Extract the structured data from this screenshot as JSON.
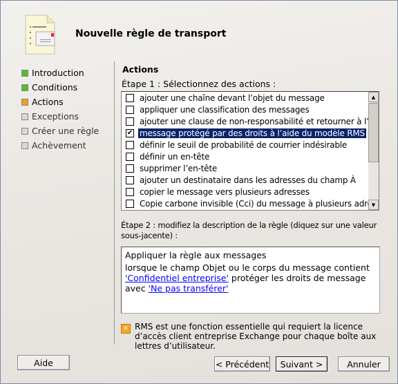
{
  "title": "Nouvelle règle de transport",
  "nav": [
    {
      "label": "Introduction",
      "state": "done"
    },
    {
      "label": "Conditions",
      "state": "done"
    },
    {
      "label": "Actions",
      "state": "current"
    },
    {
      "label": "Exceptions",
      "state": "todo"
    },
    {
      "label": "Créer une règle",
      "state": "todo"
    },
    {
      "label": "Achèvement",
      "state": "todo"
    }
  ],
  "section_title": "Actions",
  "step1_label": "Étape 1 : Sélectionnez des actions :",
  "actions": [
    {
      "label": "ajouter une chaîne devant l’objet du message",
      "checked": false
    },
    {
      "label": "appliquer une classification des messages",
      "checked": false
    },
    {
      "label": "ajouter une clause de non-responsabilité et retourner à l’action",
      "checked": false
    },
    {
      "label": "message protégé par des droits à l’aide du modèle RMS",
      "checked": true,
      "selected": true
    },
    {
      "label": "définir le seuil de probabilité de courrier indésirable",
      "checked": false
    },
    {
      "label": "définir un en-tête",
      "checked": false
    },
    {
      "label": "supprimer l’en-tête",
      "checked": false
    },
    {
      "label": "ajouter un destinataire dans les adresses du champ À",
      "checked": false
    },
    {
      "label": "copier le message vers plusieurs adresses",
      "checked": false
    },
    {
      "label": "Copie carbone invisible (Cci) du message à plusieurs adresses",
      "checked": false
    }
  ],
  "step2_label": "Étape 2 : modifiez la description de la règle (diquez sur une valeur sous-jacente) :",
  "description": {
    "line1": "Appliquer la règle aux messages",
    "line2": "lorsque le champ Objet ou le corps du message contient",
    "link1": "'Confidentiel entreprise'",
    "mid": " protéger les droits de message",
    "line3": "avec ",
    "link2": "'Ne pas transférer'"
  },
  "note": "RMS est une fonction essentielle qui requiert la licence d’accès client entreprise Exchange pour chaque boîte aux lettres d’utilisateur.",
  "buttons": {
    "help": "Aide",
    "back": "< Précédent",
    "next": "Suivant >",
    "cancel": "Annuler"
  },
  "colors": {
    "done": "#5cb82e",
    "current": "#f0a020",
    "todo": "#d8d8d8",
    "selection": "#0a246a",
    "link": "#0000ff"
  }
}
